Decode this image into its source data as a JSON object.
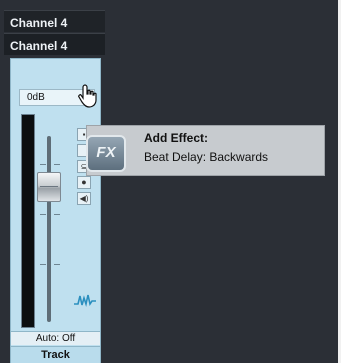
{
  "channels": [
    "Channel 4",
    "Channel 4"
  ],
  "volume_value": "0dB",
  "automation_label": "Auto: Off",
  "track_label": "Track",
  "tooltip": {
    "badge": "FX",
    "title": "Add Effect:",
    "text": "Beat Delay: Backwards"
  },
  "icons": [
    "hand-cursor-icon",
    "waveform-icon",
    "record-icon",
    "monitor-icon",
    "mute-icon",
    "solo-icon"
  ],
  "colors": {
    "background": "#2b2f36",
    "strip": "#bfe0ef",
    "tooltip": "#c7cbcf"
  }
}
